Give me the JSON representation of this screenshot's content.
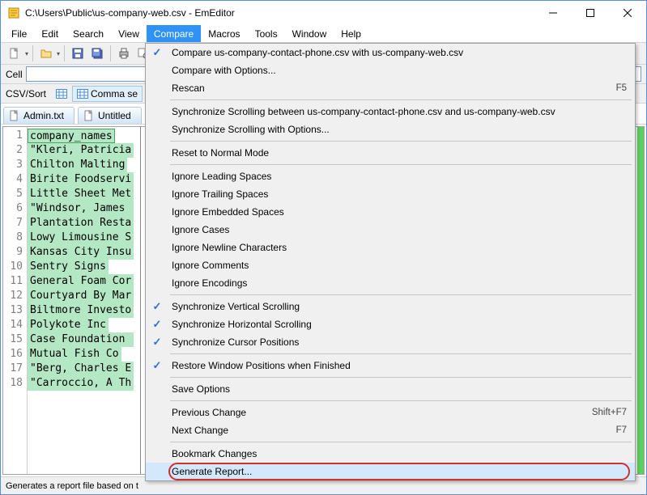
{
  "window": {
    "title": "C:\\Users\\Public\\us-company-web.csv - EmEditor"
  },
  "menubar": [
    "File",
    "Edit",
    "Search",
    "View",
    "Compare",
    "Macros",
    "Tools",
    "Window",
    "Help"
  ],
  "menubar_active_index": 4,
  "cellbar": {
    "label": "Cell"
  },
  "csvbar": {
    "label": "CSV/Sort",
    "mode": "Comma se"
  },
  "tabs": [
    {
      "label": "Admin.txt"
    },
    {
      "label": "Untitled"
    }
  ],
  "editor": {
    "rows": [
      "company_names",
      "\"Kleri, Patricia",
      "Chilton Malting",
      "Birite Foodservi",
      "Little Sheet Met",
      "\"Windsor, James ",
      "Plantation Resta",
      "Lowy Limousine S",
      "Kansas City Insu",
      "Sentry Signs",
      "General Foam Cor",
      "Courtyard By Mar",
      "Biltmore Investo",
      "Polykote Inc",
      "Case Foundation ",
      "Mutual Fish Co",
      "\"Berg, Charles E",
      "\"Carroccio, A Th"
    ]
  },
  "dropdown": {
    "sections": [
      [
        {
          "label": "Compare us-company-contact-phone.csv with us-company-web.csv",
          "checked": true
        },
        {
          "label": "Compare with Options..."
        },
        {
          "label": "Rescan",
          "shortcut": "F5"
        }
      ],
      [
        {
          "label": "Synchronize Scrolling between us-company-contact-phone.csv and us-company-web.csv"
        },
        {
          "label": "Synchronize Scrolling with Options..."
        }
      ],
      [
        {
          "label": "Reset to Normal Mode"
        }
      ],
      [
        {
          "label": "Ignore Leading Spaces"
        },
        {
          "label": "Ignore Trailing Spaces"
        },
        {
          "label": "Ignore Embedded Spaces"
        },
        {
          "label": "Ignore Cases"
        },
        {
          "label": "Ignore Newline Characters"
        },
        {
          "label": "Ignore Comments"
        },
        {
          "label": "Ignore Encodings"
        }
      ],
      [
        {
          "label": "Synchronize Vertical Scrolling",
          "checked": true
        },
        {
          "label": "Synchronize Horizontal Scrolling",
          "checked": true
        },
        {
          "label": "Synchronize Cursor Positions",
          "checked": true
        }
      ],
      [
        {
          "label": "Restore Window Positions when Finished",
          "checked": true
        }
      ],
      [
        {
          "label": "Save Options"
        }
      ],
      [
        {
          "label": "Previous Change",
          "shortcut": "Shift+F7"
        },
        {
          "label": "Next Change",
          "shortcut": "F7"
        }
      ],
      [
        {
          "label": "Bookmark Changes"
        },
        {
          "label": "Generate Report...",
          "highlighted": true
        }
      ]
    ]
  },
  "status": {
    "text": "Generates a report file based on t"
  }
}
